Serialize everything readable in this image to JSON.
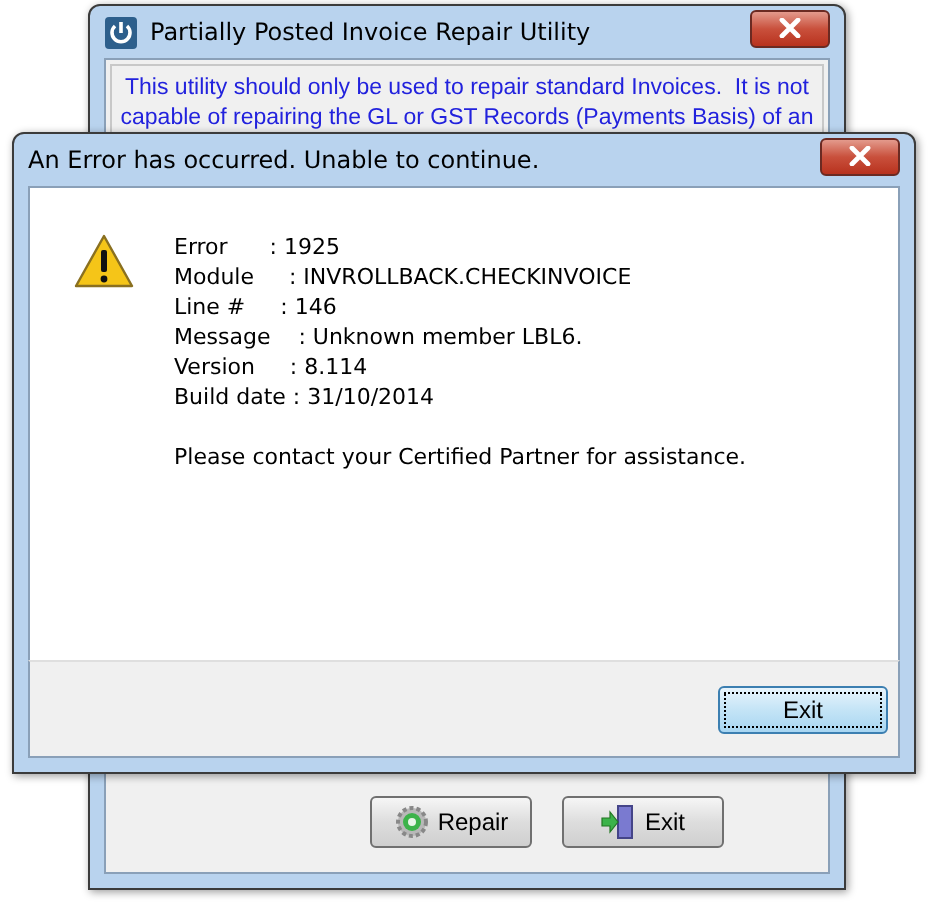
{
  "main_window": {
    "title": "Partially Posted Invoice Repair Utility",
    "notice": [
      "This utility should only be used to repair standard Invoices.  It is not",
      "capable of repairing the GL or GST Records (Payments Basis) of an"
    ],
    "buttons": [
      {
        "kind": "repair",
        "label": "Repair"
      },
      {
        "kind": "exit",
        "label": "Exit"
      }
    ]
  },
  "error_dialog": {
    "title": "An Error has occurred. Unable to continue.",
    "details": [
      "Error      : 1925",
      "Module     : INVROLLBACK.CHECKINVOICE",
      "Line #     : 146",
      "Message    : Unknown member LBL6.",
      "Version     : 8.114",
      "Build date : 31/10/2014"
    ],
    "message": "Please contact your Certified Partner for assistance.",
    "button": "Exit"
  }
}
